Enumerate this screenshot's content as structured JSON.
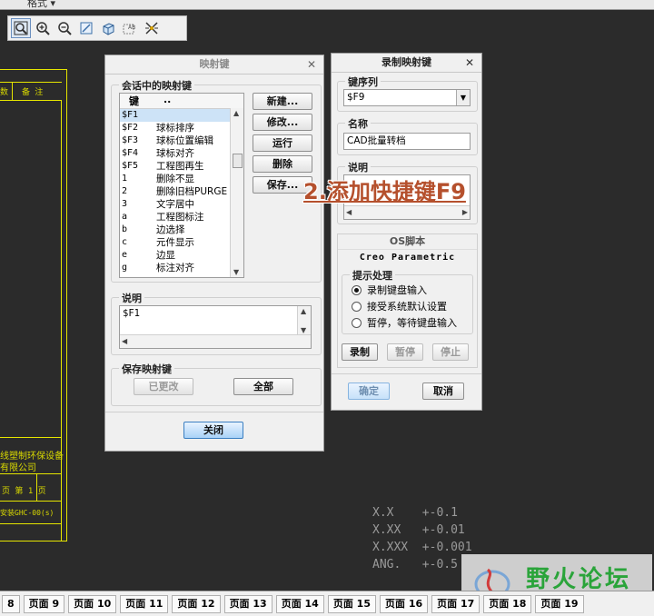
{
  "topbar": {
    "format_menu": "格式 ▾"
  },
  "toolbar": {
    "icons": [
      "zoom-fit-icon",
      "zoom-in-icon",
      "zoom-out-icon",
      "repaint-icon",
      "orientation-icon",
      "text-style-icon",
      "display-toggle-icon"
    ]
  },
  "drawing": {
    "table_headers": [
      "数",
      "备 注"
    ],
    "company_lines": [
      "线塑制环保设备",
      "有限公司"
    ],
    "sheet_text": "页  第 1 页",
    "drawing_no": "安装GHC-00(s)",
    "tolerances": "X.X    +-0.1\nX.XX   +-0.01\nX.XXX  +-0.001\nANG.   +-0.5"
  },
  "mapkeys_dialog": {
    "title": "映射键",
    "session_group": "会话中的映射键",
    "list_headers": [
      "键",
      ".."
    ],
    "rows": [
      {
        "key": "$F1",
        "value": ""
      },
      {
        "key": "$F2",
        "value": "球标排序"
      },
      {
        "key": "$F3",
        "value": "球标位置编辑"
      },
      {
        "key": "$F4",
        "value": "球标对齐"
      },
      {
        "key": "$F5",
        "value": "工程图再生"
      },
      {
        "key": "1",
        "value": "删除不显"
      },
      {
        "key": "2",
        "value": "删除旧档PURGE"
      },
      {
        "key": "3",
        "value": "文字居中"
      },
      {
        "key": "a",
        "value": "工程图标注"
      },
      {
        "key": "b",
        "value": "边选择"
      },
      {
        "key": "c",
        "value": "元件显示"
      },
      {
        "key": "e",
        "value": "边显"
      },
      {
        "key": "g",
        "value": "标注对齐"
      }
    ],
    "buttons": {
      "new": "新建...",
      "modify": "修改...",
      "run": "运行",
      "delete": "删除",
      "save": "保存..."
    },
    "desc_group": "说明",
    "desc_value": "$F1",
    "save_group": "保存映射键",
    "changed": "已更改",
    "all": "全部",
    "close": "关闭"
  },
  "record_dialog": {
    "title": "录制映射键",
    "key_seq_label": "键序列",
    "key_seq_value": "$F9",
    "name_label": "名称",
    "name_value": "CAD批量转档",
    "desc_label": "说明",
    "os_script_label": "OS脚本",
    "tab_name": "Creo Parametric",
    "prompt_group": "提示处理",
    "radio_options": [
      "录制键盘输入",
      "接受系统默认设置",
      "暂停，等待键盘输入"
    ],
    "selected_option": 0,
    "record": "录制",
    "pause": "暂停",
    "stop": "停止",
    "ok": "确定",
    "cancel": "取消"
  },
  "annotation": "2.添加快捷键F9",
  "page_tabs": [
    "8",
    "页面 9",
    "页面 10",
    "页面 11",
    "页面 12",
    "页面 13",
    "页面 14",
    "页面 15",
    "页面 16",
    "页面 17",
    "页面 18",
    "页面 19"
  ],
  "watermark": "野火论坛",
  "colors": {
    "cad_line": "#e6e600",
    "annotation": "#b5502d",
    "watermark": "#2aa43a",
    "selection": "#cde3f7"
  }
}
